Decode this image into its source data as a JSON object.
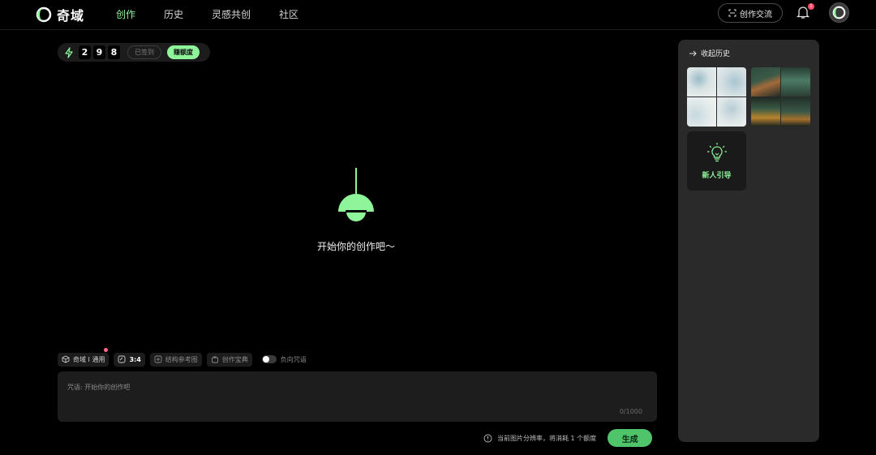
{
  "brand": {
    "name": "奇域"
  },
  "nav": {
    "items": [
      {
        "label": "创作",
        "active": true
      },
      {
        "label": "历史",
        "active": false
      },
      {
        "label": "灵感共创",
        "active": false
      },
      {
        "label": "社区",
        "active": false
      }
    ]
  },
  "header": {
    "community_label": "创作交流",
    "notification_count": "1"
  },
  "credits": {
    "digits": [
      "2",
      "9",
      "8"
    ],
    "signed_label": "已签到",
    "earn_label": "赚额度"
  },
  "empty_state": {
    "text": "开始你的创作吧～"
  },
  "options": {
    "model_label": "奇域 I 通用",
    "ratio_label": "3:4",
    "structure_ref_label": "结构参考图",
    "manual_label": "创作宝典",
    "negative_label": "负向咒语",
    "negative_enabled": false
  },
  "prompt": {
    "placeholder": "咒语: 开始你的创作吧",
    "counter": "0/1000"
  },
  "generate": {
    "hint": "当前图片分辨率，将消耗 1 个额度",
    "button_label": "生成"
  },
  "history": {
    "collapse_label": "收起历史",
    "guide_label": "新人引导"
  },
  "colors": {
    "accent": "#8ef59a",
    "generate_button": "#4fc46b",
    "panel": "#2a2a2a",
    "background": "#000000"
  }
}
